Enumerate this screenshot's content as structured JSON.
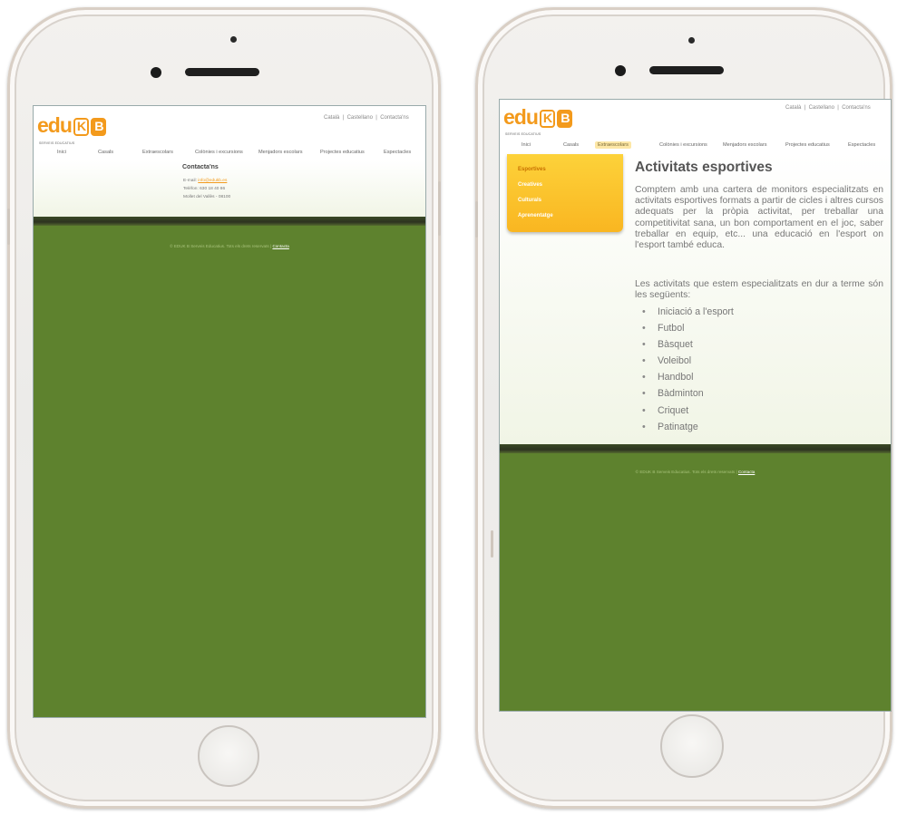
{
  "brand": {
    "logo_text": "edu",
    "logo_k": "K",
    "logo_b": "B",
    "logo_sub": "SERVEIS EDUCATIUS"
  },
  "languages": {
    "catala": "Català",
    "sep1": "|",
    "castellano": "Castellano",
    "sep2": "|",
    "contact": "Contacta'ns"
  },
  "nav": {
    "items": [
      "Inici",
      "Casals",
      "Extraescolars",
      "Colònies i excursions",
      "Menjadors escolars",
      "Projectes educatius",
      "Espectacles"
    ],
    "active_right": "Extraescolars"
  },
  "contact_page": {
    "title": "Contacta'ns",
    "email_label": "E-mail:",
    "email": "info@edukb.es",
    "phone": "Telèfon: 630 18 40 86",
    "address": "Mollet del Vallès - 08100"
  },
  "activities_page": {
    "menu": [
      "Esportives",
      "Creatives",
      "Culturals",
      "Aprenentatge"
    ],
    "selected": "Esportives",
    "title": "Activitats esportives",
    "paragraph1": "Comptem amb una cartera de monitors especialitzats en activitats esportives formats a partir de cicles i altres cursos adequats per la pròpia activitat, per treballar una competitivitat sana, un bon comportament en el joc, saber treballar en equip, etc... una educació en l'esport on l'esport també educa.",
    "paragraph2": "Les activitats que estem especialitzats en dur a terme són les següents:",
    "list": [
      "Iniciació a l'esport",
      "Futbol",
      "Bàsquet",
      "Voleibol",
      "Handbol",
      "Bàdminton",
      "Criquet",
      "Patinatge"
    ]
  },
  "footer": {
    "text": "© EDUK B Serveis Educatius. Tots els drets reservats |",
    "link": "Contacta"
  },
  "colors": {
    "brand_orange": "#f39a1c",
    "footer_green": "#5e822e",
    "menu_yellow": "#fdd23a"
  }
}
